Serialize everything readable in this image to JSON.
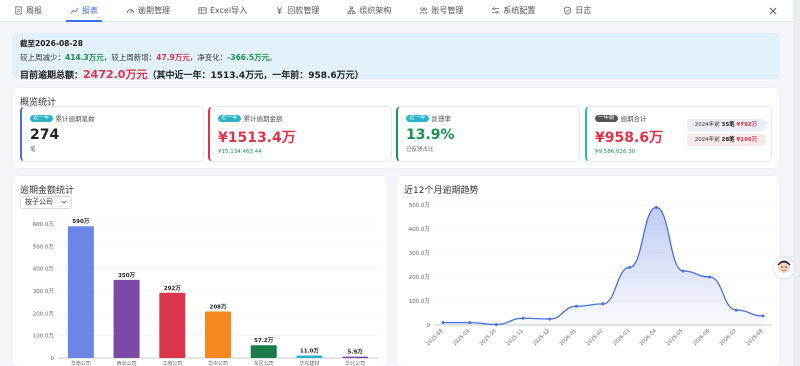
{
  "nav": {
    "items": [
      {
        "label": "周报",
        "icon": "document-icon"
      },
      {
        "label": "报表",
        "icon": "line-chart-icon",
        "active": true
      },
      {
        "label": "逾期管理",
        "icon": "gauge-icon"
      },
      {
        "label": "Excel导入",
        "icon": "table-icon"
      },
      {
        "label": "回款管理",
        "icon": "yen-icon"
      },
      {
        "label": "组织架构",
        "icon": "org-icon"
      },
      {
        "label": "账号管理",
        "icon": "user-group-icon"
      },
      {
        "label": "系统配置",
        "icon": "settings-sliders-icon"
      },
      {
        "label": "日志",
        "icon": "shield-icon"
      }
    ]
  },
  "banner": {
    "date": "截至2026-08-28",
    "change_prefix": "较上周减少：",
    "decrease": "414.3万元",
    "change_mid": "，较上周新增：",
    "increase": "47.9万元",
    "change_net_prefix": "，净变化：",
    "net": "-366.5万元",
    "change_suffix": "。",
    "total_prefix": "目前逾期总额：",
    "total": "2472.0万元",
    "total_suffix": "（其中近一年：1513.4万元，一年前：958.6万元）"
  },
  "overview": {
    "title": "概览统计",
    "stats": [
      {
        "tag": "近一年",
        "label": "累计逾期笔数",
        "value": "274",
        "sub": "笔",
        "color": "#4a6fd8",
        "value_color": "#222"
      },
      {
        "tag": "近一年",
        "label": "累计逾期金额",
        "value": "¥1513.4万",
        "sub": "¥15,134,463.44",
        "color": "#e0334a",
        "value_color": "#e0334a"
      },
      {
        "tag": "近一年",
        "label": "反馈率",
        "value": "13.9%",
        "sub": "已反馈占比",
        "color": "#17924f",
        "value_color": "#17924f"
      },
      {
        "tag": "一年前",
        "label": "逾期合计",
        "value": "¥958.6万",
        "sub": "¥9,586,026.30",
        "color": "#2ab3c8",
        "value_color": "#e0334a"
      }
    ],
    "older_badges": [
      {
        "text": "2024年前 ",
        "count": "35笔",
        "amount": "¥792万"
      },
      {
        "text": "2024年前 ",
        "count": "28笔",
        "amount": "¥166万"
      }
    ]
  },
  "amount_chart": {
    "title": "逾期金额统计",
    "select": "按子公司",
    "chart_data": {
      "type": "bar",
      "categories": [
        "华南公司",
        "西北公司",
        "江南公司",
        "华中公司",
        "东区公司",
        "华东建材",
        "华北公司"
      ],
      "values": [
        590,
        350,
        292,
        208,
        57.2,
        11.0,
        5.9
      ],
      "value_labels": [
        "590万",
        "350万",
        "292万",
        "208万",
        "57.2万",
        "11.0万",
        "5.9万"
      ],
      "colors": [
        "#6d86e6",
        "#7a4aa6",
        "#d9364d",
        "#f5891f",
        "#1a7a4a",
        "#2ab3c8",
        "#7a4aa6"
      ],
      "yticks": [
        "0",
        "100.0万",
        "200.0万",
        "300.0万",
        "400.0万",
        "500.0万",
        "600.0万"
      ],
      "ylim": [
        0,
        600
      ]
    }
  },
  "trend_chart": {
    "title": "近12个月逾期趋势",
    "chart_data": {
      "type": "area",
      "x": [
        "2025-08",
        "2025-09",
        "2025-10",
        "2025-11",
        "2025-12",
        "2026-01",
        "2026-02",
        "2026-03",
        "2026-04",
        "2026-05",
        "2026-06",
        "2026-07",
        "2026-08"
      ],
      "values": [
        10,
        10,
        2,
        28,
        25,
        78,
        88,
        240,
        490,
        225,
        200,
        62,
        38
      ],
      "yticks": [
        "0",
        "100.0万",
        "200.0万",
        "300.0万",
        "400.0万",
        "500.0万"
      ],
      "ylim": [
        0,
        500
      ],
      "color": "#4a6fd8"
    }
  }
}
